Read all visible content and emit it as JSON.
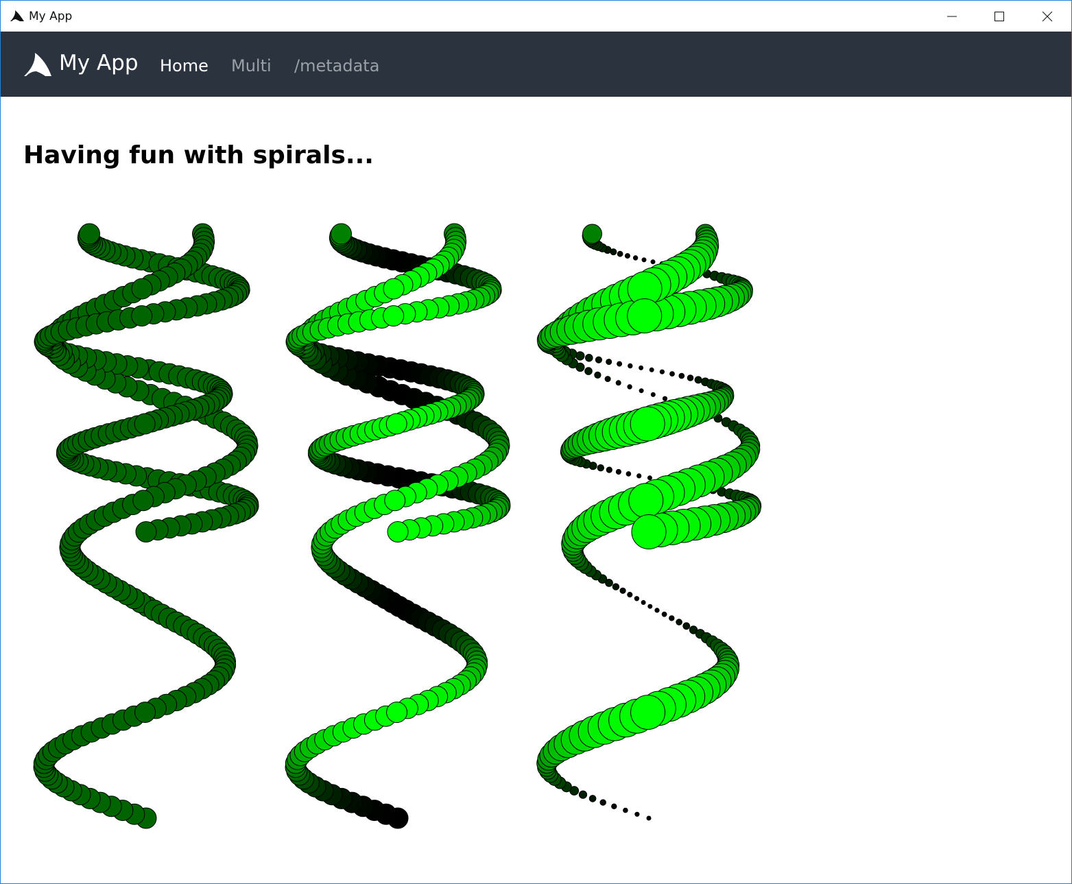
{
  "window": {
    "title": "My App",
    "controls": {
      "minimize_icon": "minimize-icon",
      "maximize_icon": "maximize-icon",
      "close_icon": "close-icon"
    }
  },
  "navbar": {
    "brand": "My App",
    "brand_icon": "shark-fin-logo-icon",
    "links": [
      {
        "label": "Home",
        "active": true
      },
      {
        "label": "Multi",
        "active": false
      },
      {
        "label": "/metadata",
        "active": false
      }
    ]
  },
  "main": {
    "heading": "Having fun with spirals..."
  },
  "colors": {
    "navbar_bg": "#2b333f",
    "spiral_dark_green": "#006400",
    "spiral_bright_green": "#00ff00",
    "spiral_black": "#000000",
    "circle_stroke": "#000000"
  },
  "spirals": [
    {
      "name": "spiral-uniform",
      "front_color": "#006400",
      "back_color": "#006400",
      "size_mode": "constant"
    },
    {
      "name": "spiral-gradient",
      "front_color": "#00ff00",
      "back_color": "#000000",
      "size_mode": "constant"
    },
    {
      "name": "spiral-gradient-size",
      "front_color": "#00ff00",
      "back_color": "#000000",
      "size_mode": "varying"
    }
  ]
}
